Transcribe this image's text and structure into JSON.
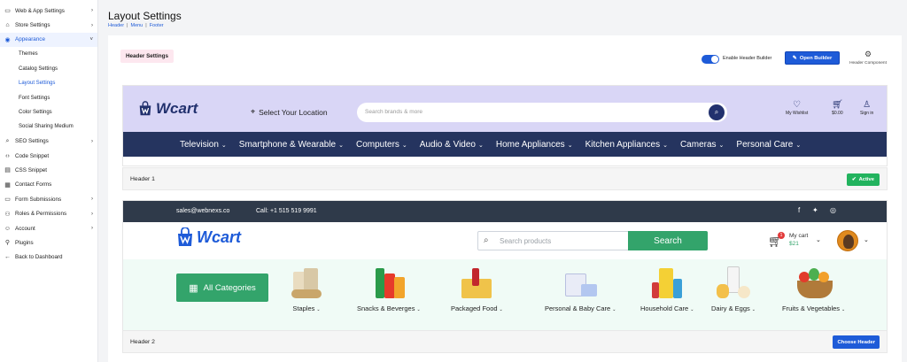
{
  "sidebar": {
    "items": [
      {
        "label": "Web & App Settings",
        "icon": "monitor-icon",
        "chevron": "›",
        "active": false
      },
      {
        "label": "Store Settings",
        "icon": "store-icon",
        "chevron": "›",
        "active": false
      },
      {
        "label": "Appearance",
        "icon": "palette-icon",
        "chevron": "˅",
        "active": true
      }
    ],
    "sub_items": [
      "Themes",
      "Catalog Settings",
      "Layout Settings",
      "Font Settings",
      "Color Settings",
      "Social Sharing Medium"
    ],
    "active_sub": "Layout Settings",
    "items_after": [
      {
        "label": "SEO Settings",
        "icon": "search-icon",
        "chevron": "›"
      },
      {
        "label": "Code Snippet",
        "icon": "code-icon",
        "chevron": ""
      },
      {
        "label": "CSS Snippet",
        "icon": "css-file-icon",
        "chevron": ""
      },
      {
        "label": "Contact Forms",
        "icon": "contact-icon",
        "chevron": ""
      },
      {
        "label": "Form Submissions",
        "icon": "form-icon",
        "chevron": "›"
      },
      {
        "label": "Roles & Permissions",
        "icon": "users-icon",
        "chevron": "›"
      },
      {
        "label": "Account",
        "icon": "user-icon",
        "chevron": "›"
      },
      {
        "label": "Plugins",
        "icon": "plug-icon",
        "chevron": ""
      },
      {
        "label": "Back to Dashboard",
        "icon": "back-icon",
        "chevron": ""
      }
    ]
  },
  "page": {
    "title": "Layout Settings",
    "crumbs": [
      "Header",
      "Menu",
      "Footer"
    ],
    "crumb_sep": "|"
  },
  "toolbar": {
    "section_label": "Header Settings",
    "toggle_label": "Enable Header Builder",
    "toggle_on": true,
    "open_builder": "Open Builder",
    "header_component": "Header Component"
  },
  "header1": {
    "logo": "Wcart",
    "location": "Select Your Location",
    "search_placeholder": "Search brands & more",
    "icons": [
      {
        "label": "My Wishlist",
        "icon": "heart-icon"
      },
      {
        "label": "$0.00",
        "icon": "cart-icon"
      },
      {
        "label": "Sign in",
        "icon": "user-icon"
      }
    ],
    "nav": [
      "Television",
      "Smartphone & Wearable",
      "Computers",
      "Audio & Video",
      "Home Appliances",
      "Kitchen Appliances",
      "Cameras",
      "Personal Care"
    ],
    "row_label": "Header 1",
    "status": "Active"
  },
  "header2": {
    "email": "sales@webnexs.co",
    "phone": "Call: +1 515 519 9991",
    "social": [
      "f",
      "twitter",
      "instagram"
    ],
    "logo": "Wcart",
    "search_placeholder": "Search products",
    "search_button": "Search",
    "cart_label": "My cart",
    "cart_amount": "$21",
    "cart_count": "1",
    "all_categories": "All Categories",
    "categories": [
      "Staples",
      "Snacks & Beverges",
      "Packaged Food",
      "Personal & Baby Care",
      "Household Care",
      "Dairy & Eggs",
      "Fruits & Vegetables"
    ],
    "row_label": "Header 2",
    "choose_button": "Choose Header"
  },
  "colors": {
    "accent": "#1e5bd8",
    "header1_bg": "#d9d6f6",
    "header1_nav": "#25345f",
    "green": "#33a46b",
    "active_green": "#22b35e"
  }
}
